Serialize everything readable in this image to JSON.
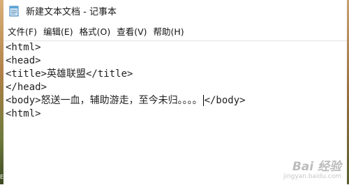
{
  "window": {
    "title": "新建文本文档 - 记事本",
    "icon": "notepad-icon"
  },
  "menu": [
    {
      "label": "文件(F)",
      "name": "menu-file"
    },
    {
      "label": "编辑(E)",
      "name": "menu-edit"
    },
    {
      "label": "格式(O)",
      "name": "menu-format"
    },
    {
      "label": "查看(V)",
      "name": "menu-view"
    },
    {
      "label": "帮助(H)",
      "name": "menu-help"
    }
  ],
  "editor": {
    "lines": [
      "<html>",
      "<head>",
      "<title>英雄联盟</title>",
      "</head>",
      "<body>怒送一血，辅助游走，至今未归。。。。",
      "<html>"
    ],
    "line5_after_caret": "</body>"
  },
  "watermark": {
    "main": "Bai 经验",
    "url": "jingyan.baidu.com"
  },
  "colors": {
    "text": "#222222",
    "watermark": "#b5b5b5"
  }
}
